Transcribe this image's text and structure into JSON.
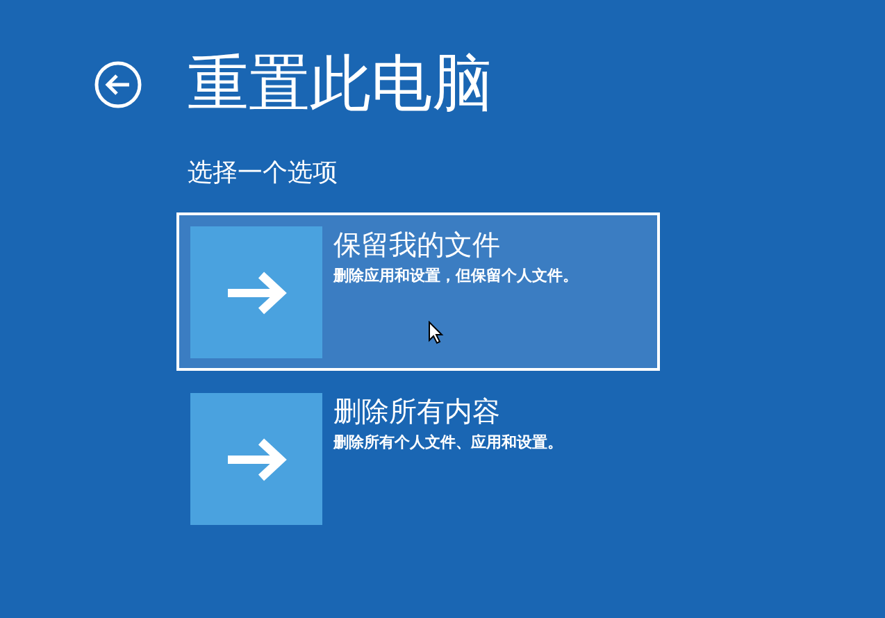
{
  "title": "重置此电脑",
  "subtitle": "选择一个选项",
  "options": [
    {
      "title": "保留我的文件",
      "description": "删除应用和设置，但保留个人文件。",
      "selected": true
    },
    {
      "title": "删除所有内容",
      "description": "删除所有个人文件、应用和设置。",
      "selected": false
    }
  ]
}
